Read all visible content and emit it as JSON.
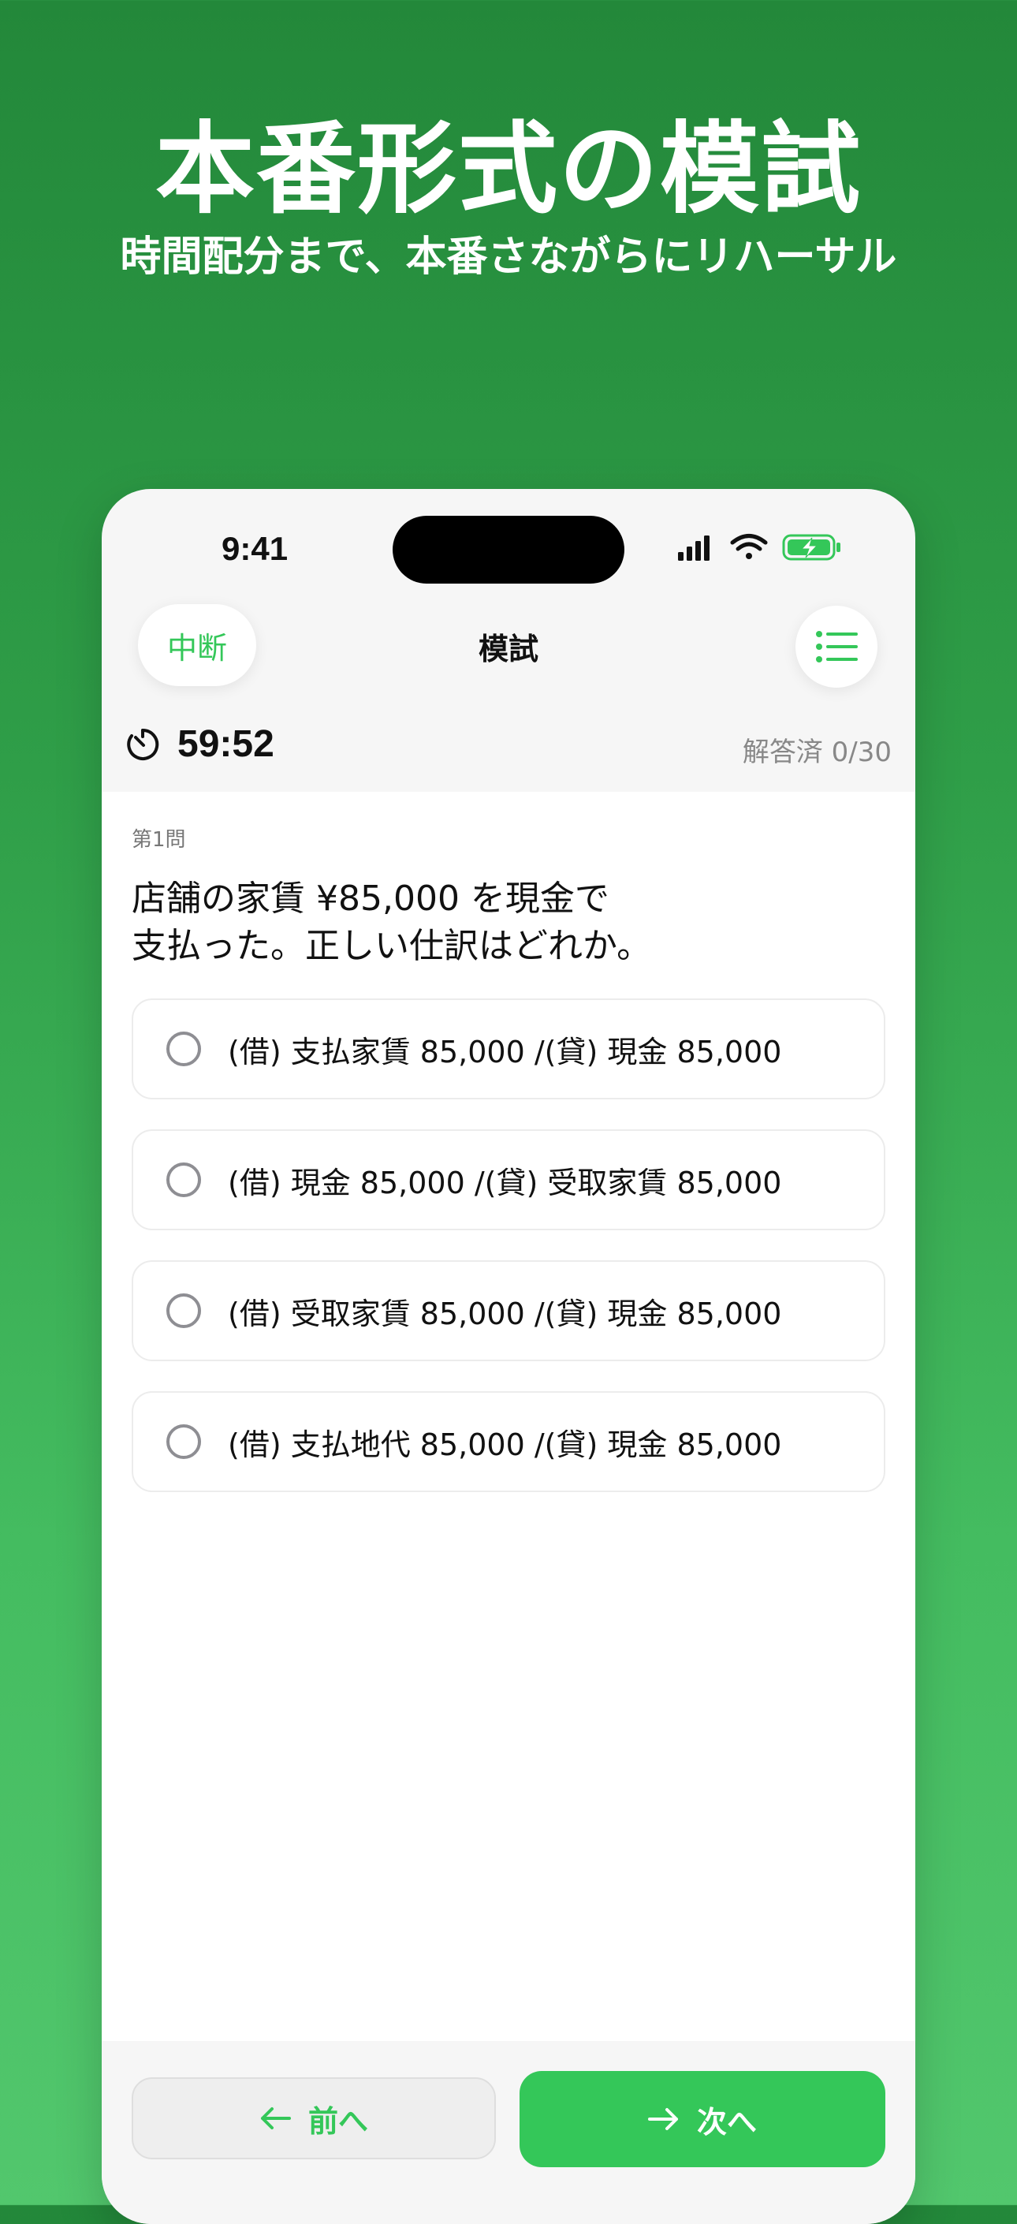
{
  "promo": {
    "headline": "本番形式の模試",
    "subline": "時間配分まで、本番さながらにリハーサル"
  },
  "status_bar": {
    "time": "9:41",
    "icons": [
      "signal-icon",
      "wifi-icon",
      "battery-charging-icon"
    ]
  },
  "nav": {
    "pause_label": "中断",
    "title": "模試",
    "list_icon": "list-icon"
  },
  "exam": {
    "timer": "59:52",
    "answered": "解答済 0/30"
  },
  "question": {
    "number": "第1問",
    "line1": "店舗の家賃 ¥85,000 を現金で",
    "line2": "支払った。正しい仕訳はどれか。",
    "options": [
      "(借) 支払家賃 85,000 /(貸) 現金 85,000",
      "(借) 現金 85,000 /(貸) 受取家賃 85,000",
      "(借) 受取家賃 85,000 /(貸) 現金 85,000",
      "(借) 支払地代 85,000 /(貸) 現金 85,000"
    ]
  },
  "footer": {
    "prev_label": "前へ",
    "next_label": "次へ"
  },
  "colors": {
    "accent": "#34c759",
    "background_top": "#23883a",
    "background_bottom": "#52c76d"
  }
}
